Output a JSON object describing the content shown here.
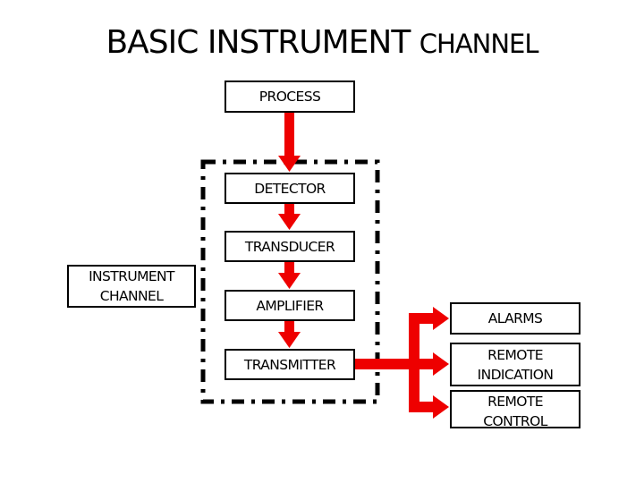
{
  "title": {
    "main": "BASIC INSTRUMENT",
    "tail": "CHANNEL"
  },
  "flow": {
    "process": "PROCESS",
    "stages": [
      "DETECTOR",
      "TRANSDUCER",
      "AMPLIFIER",
      "TRANSMITTER"
    ]
  },
  "group_label": {
    "line1": "INSTRUMENT",
    "line2": "CHANNEL"
  },
  "outputs": {
    "alarms": "ALARMS",
    "remote_indication": {
      "line1": "REMOTE",
      "line2": "INDICATION"
    },
    "remote_control": {
      "line1": "REMOTE",
      "line2": "CONTROL"
    }
  },
  "colors": {
    "arrow": "#ee0000",
    "border": "#000000"
  }
}
